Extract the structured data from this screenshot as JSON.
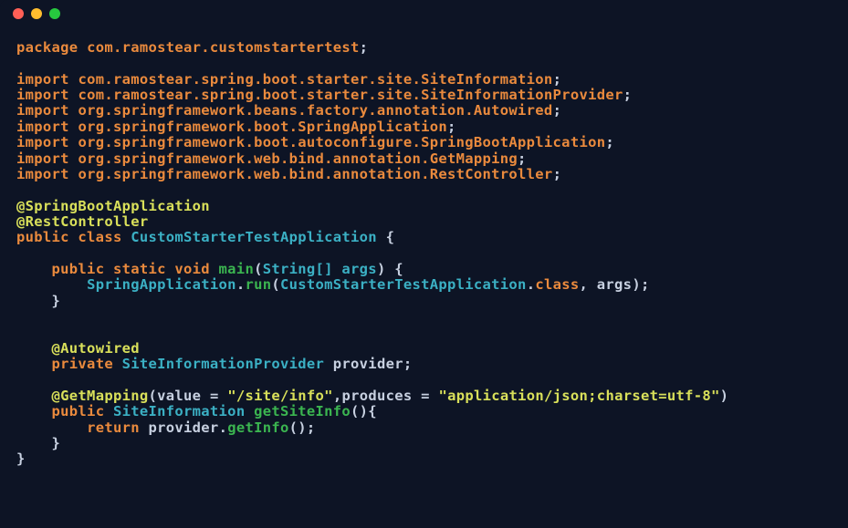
{
  "code": {
    "l1": {
      "kw": "package",
      "pkg": "com.ramostear.customstartertest"
    },
    "l2": {
      "kw": "import",
      "pkg": "com.ramostear.spring.boot.starter.site.SiteInformation"
    },
    "l3": {
      "kw": "import",
      "pkg": "com.ramostear.spring.boot.starter.site.SiteInformationProvider"
    },
    "l4": {
      "kw": "import",
      "pkg": "org.springframework.beans.factory.annotation.Autowired"
    },
    "l5": {
      "kw": "import",
      "pkg": "org.springframework.boot.SpringApplication"
    },
    "l6": {
      "kw": "import",
      "pkg": "org.springframework.boot.autoconfigure.SpringBootApplication"
    },
    "l7": {
      "kw": "import",
      "pkg": "org.springframework.web.bind.annotation.GetMapping"
    },
    "l8": {
      "kw": "import",
      "pkg": "org.springframework.web.bind.annotation.RestController"
    },
    "ann1": "@SpringBootApplication",
    "ann2": "@RestController",
    "classDecl": {
      "mod": "public class",
      "name": "CustomStarterTestApplication"
    },
    "main": {
      "mod": "public static void",
      "name": "main",
      "params": "String[] args"
    },
    "mainBody": {
      "cls": "SpringApplication",
      "mth": "run",
      "arg1": "CustomStarterTestApplication",
      "arg2": "args"
    },
    "ann3": "@Autowired",
    "field": {
      "mod": "private",
      "type": "SiteInformationProvider",
      "name": "provider"
    },
    "ann4": {
      "name": "@GetMapping",
      "k1": "value",
      "v1": "\"/site/info\"",
      "k2": "produces",
      "v2": "\"application/json;charset=utf-8\""
    },
    "method2": {
      "mod": "public",
      "type": "SiteInformation",
      "name": "getSiteInfo"
    },
    "ret": {
      "kw": "return",
      "obj": "provider",
      "mth": "getInfo"
    }
  }
}
